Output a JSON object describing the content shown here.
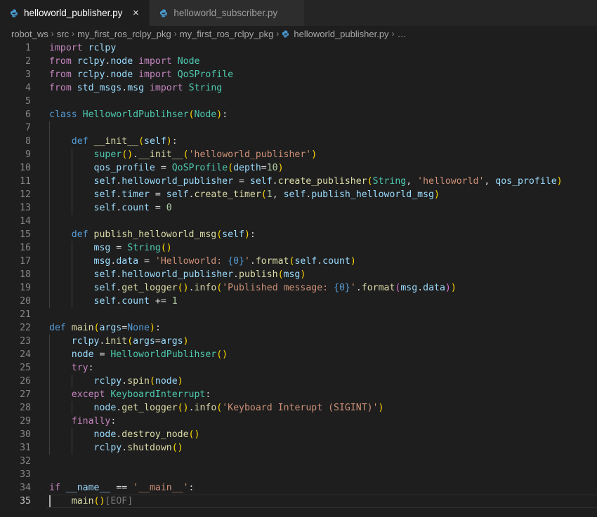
{
  "tabs": [
    {
      "label": "helloworld_publisher.py",
      "active": true,
      "close": "×"
    },
    {
      "label": "helloworld_subscriber.py",
      "active": false,
      "close": "×"
    }
  ],
  "breadcrumb": {
    "items": [
      "robot_ws",
      "src",
      "my_first_ros_rclpy_pkg",
      "my_first_ros_rclpy_pkg",
      "helloworld_publisher.py",
      "…"
    ]
  },
  "editor": {
    "current_line": 35,
    "lines": [
      [
        {
          "t": "import",
          "c": "k"
        },
        {
          "t": " "
        },
        {
          "t": "rclpy",
          "c": "v"
        }
      ],
      [
        {
          "t": "from",
          "c": "k"
        },
        {
          "t": " "
        },
        {
          "t": "rclpy",
          "c": "v"
        },
        {
          "t": "."
        },
        {
          "t": "node",
          "c": "v"
        },
        {
          "t": " "
        },
        {
          "t": "import",
          "c": "k"
        },
        {
          "t": " "
        },
        {
          "t": "Node",
          "c": "cl"
        }
      ],
      [
        {
          "t": "from",
          "c": "k"
        },
        {
          "t": " "
        },
        {
          "t": "rclpy",
          "c": "v"
        },
        {
          "t": "."
        },
        {
          "t": "node",
          "c": "v"
        },
        {
          "t": " "
        },
        {
          "t": "import",
          "c": "k"
        },
        {
          "t": " "
        },
        {
          "t": "QoSProfile",
          "c": "cl"
        }
      ],
      [
        {
          "t": "from",
          "c": "k"
        },
        {
          "t": " "
        },
        {
          "t": "std_msgs",
          "c": "v"
        },
        {
          "t": "."
        },
        {
          "t": "msg",
          "c": "v"
        },
        {
          "t": " "
        },
        {
          "t": "import",
          "c": "k"
        },
        {
          "t": " "
        },
        {
          "t": "String",
          "c": "cl"
        }
      ],
      [],
      [
        {
          "t": "class",
          "c": "kd"
        },
        {
          "t": " "
        },
        {
          "t": "HelloworldPublihser",
          "c": "cl"
        },
        {
          "t": "(",
          "c": "b1"
        },
        {
          "t": "Node",
          "c": "cl"
        },
        {
          "t": ")",
          "c": "b1"
        },
        {
          "t": ":"
        }
      ],
      [],
      [
        {
          "t": "    "
        },
        {
          "t": "def",
          "c": "kd"
        },
        {
          "t": " "
        },
        {
          "t": "__init__",
          "c": "fn"
        },
        {
          "t": "(",
          "c": "b1"
        },
        {
          "t": "self",
          "c": "v"
        },
        {
          "t": ")",
          "c": "b1"
        },
        {
          "t": ":"
        }
      ],
      [
        {
          "t": "        "
        },
        {
          "t": "super",
          "c": "cl"
        },
        {
          "t": "(",
          "c": "b1"
        },
        {
          "t": ")",
          "c": "b1"
        },
        {
          "t": "."
        },
        {
          "t": "__init__",
          "c": "fn"
        },
        {
          "t": "(",
          "c": "b1"
        },
        {
          "t": "'helloworld_publisher'",
          "c": "s"
        },
        {
          "t": ")",
          "c": "b1"
        }
      ],
      [
        {
          "t": "        "
        },
        {
          "t": "qos_profile",
          "c": "v"
        },
        {
          "t": " = "
        },
        {
          "t": "QoSProfile",
          "c": "cl"
        },
        {
          "t": "(",
          "c": "b1"
        },
        {
          "t": "depth",
          "c": "v"
        },
        {
          "t": "="
        },
        {
          "t": "10",
          "c": "n"
        },
        {
          "t": ")",
          "c": "b1"
        }
      ],
      [
        {
          "t": "        "
        },
        {
          "t": "self",
          "c": "v"
        },
        {
          "t": "."
        },
        {
          "t": "helloworld_publisher",
          "c": "v"
        },
        {
          "t": " = "
        },
        {
          "t": "self",
          "c": "v"
        },
        {
          "t": "."
        },
        {
          "t": "create_publisher",
          "c": "fn"
        },
        {
          "t": "(",
          "c": "b1"
        },
        {
          "t": "String",
          "c": "cl"
        },
        {
          "t": ", "
        },
        {
          "t": "'helloworld'",
          "c": "s"
        },
        {
          "t": ", "
        },
        {
          "t": "qos_profile",
          "c": "v"
        },
        {
          "t": ")",
          "c": "b1"
        }
      ],
      [
        {
          "t": "        "
        },
        {
          "t": "self",
          "c": "v"
        },
        {
          "t": "."
        },
        {
          "t": "timer",
          "c": "v"
        },
        {
          "t": " = "
        },
        {
          "t": "self",
          "c": "v"
        },
        {
          "t": "."
        },
        {
          "t": "create_timer",
          "c": "fn"
        },
        {
          "t": "(",
          "c": "b1"
        },
        {
          "t": "1",
          "c": "n"
        },
        {
          "t": ", "
        },
        {
          "t": "self",
          "c": "v"
        },
        {
          "t": "."
        },
        {
          "t": "publish_helloworld_msg",
          "c": "v"
        },
        {
          "t": ")",
          "c": "b1"
        }
      ],
      [
        {
          "t": "        "
        },
        {
          "t": "self",
          "c": "v"
        },
        {
          "t": "."
        },
        {
          "t": "count",
          "c": "v"
        },
        {
          "t": " = "
        },
        {
          "t": "0",
          "c": "n"
        }
      ],
      [],
      [
        {
          "t": "    "
        },
        {
          "t": "def",
          "c": "kd"
        },
        {
          "t": " "
        },
        {
          "t": "publish_helloworld_msg",
          "c": "fn"
        },
        {
          "t": "(",
          "c": "b1"
        },
        {
          "t": "self",
          "c": "v"
        },
        {
          "t": ")",
          "c": "b1"
        },
        {
          "t": ":"
        }
      ],
      [
        {
          "t": "        "
        },
        {
          "t": "msg",
          "c": "v"
        },
        {
          "t": " = "
        },
        {
          "t": "String",
          "c": "cl"
        },
        {
          "t": "(",
          "c": "b1"
        },
        {
          "t": ")",
          "c": "b1"
        }
      ],
      [
        {
          "t": "        "
        },
        {
          "t": "msg",
          "c": "v"
        },
        {
          "t": "."
        },
        {
          "t": "data",
          "c": "v"
        },
        {
          "t": " = "
        },
        {
          "t": "'Helloworld: ",
          "c": "s"
        },
        {
          "t": "{0}",
          "c": "fmt"
        },
        {
          "t": "'",
          "c": "s"
        },
        {
          "t": "."
        },
        {
          "t": "format",
          "c": "fn"
        },
        {
          "t": "(",
          "c": "b1"
        },
        {
          "t": "self",
          "c": "v"
        },
        {
          "t": "."
        },
        {
          "t": "count",
          "c": "v"
        },
        {
          "t": ")",
          "c": "b1"
        }
      ],
      [
        {
          "t": "        "
        },
        {
          "t": "self",
          "c": "v"
        },
        {
          "t": "."
        },
        {
          "t": "helloworld_publisher",
          "c": "v"
        },
        {
          "t": "."
        },
        {
          "t": "publish",
          "c": "fn"
        },
        {
          "t": "(",
          "c": "b1"
        },
        {
          "t": "msg",
          "c": "v"
        },
        {
          "t": ")",
          "c": "b1"
        }
      ],
      [
        {
          "t": "        "
        },
        {
          "t": "self",
          "c": "v"
        },
        {
          "t": "."
        },
        {
          "t": "get_logger",
          "c": "fn"
        },
        {
          "t": "(",
          "c": "b1"
        },
        {
          "t": ")",
          "c": "b1"
        },
        {
          "t": "."
        },
        {
          "t": "info",
          "c": "fn"
        },
        {
          "t": "(",
          "c": "b1"
        },
        {
          "t": "'Published message: ",
          "c": "s"
        },
        {
          "t": "{0}",
          "c": "fmt"
        },
        {
          "t": "'",
          "c": "s"
        },
        {
          "t": "."
        },
        {
          "t": "format",
          "c": "fn"
        },
        {
          "t": "(",
          "c": "b2"
        },
        {
          "t": "msg",
          "c": "v"
        },
        {
          "t": "."
        },
        {
          "t": "data",
          "c": "v"
        },
        {
          "t": ")",
          "c": "b2"
        },
        {
          "t": ")",
          "c": "b1"
        }
      ],
      [
        {
          "t": "        "
        },
        {
          "t": "self",
          "c": "v"
        },
        {
          "t": "."
        },
        {
          "t": "count",
          "c": "v"
        },
        {
          "t": " += "
        },
        {
          "t": "1",
          "c": "n"
        }
      ],
      [],
      [
        {
          "t": "def",
          "c": "kd"
        },
        {
          "t": " "
        },
        {
          "t": "main",
          "c": "fn"
        },
        {
          "t": "(",
          "c": "b1"
        },
        {
          "t": "args",
          "c": "v"
        },
        {
          "t": "="
        },
        {
          "t": "None",
          "c": "kd"
        },
        {
          "t": ")",
          "c": "b1"
        },
        {
          "t": ":"
        }
      ],
      [
        {
          "t": "    "
        },
        {
          "t": "rclpy",
          "c": "v"
        },
        {
          "t": "."
        },
        {
          "t": "init",
          "c": "fn"
        },
        {
          "t": "(",
          "c": "b1"
        },
        {
          "t": "args",
          "c": "v"
        },
        {
          "t": "="
        },
        {
          "t": "args",
          "c": "v"
        },
        {
          "t": ")",
          "c": "b1"
        }
      ],
      [
        {
          "t": "    "
        },
        {
          "t": "node",
          "c": "v"
        },
        {
          "t": " = "
        },
        {
          "t": "HelloworldPublihser",
          "c": "cl"
        },
        {
          "t": "(",
          "c": "b1"
        },
        {
          "t": ")",
          "c": "b1"
        }
      ],
      [
        {
          "t": "    "
        },
        {
          "t": "try",
          "c": "k"
        },
        {
          "t": ":"
        }
      ],
      [
        {
          "t": "        "
        },
        {
          "t": "rclpy",
          "c": "v"
        },
        {
          "t": "."
        },
        {
          "t": "spin",
          "c": "fn"
        },
        {
          "t": "(",
          "c": "b1"
        },
        {
          "t": "node",
          "c": "v"
        },
        {
          "t": ")",
          "c": "b1"
        }
      ],
      [
        {
          "t": "    "
        },
        {
          "t": "except",
          "c": "k"
        },
        {
          "t": " "
        },
        {
          "t": "KeyboardInterrupt",
          "c": "cl"
        },
        {
          "t": ":"
        }
      ],
      [
        {
          "t": "        "
        },
        {
          "t": "node",
          "c": "v"
        },
        {
          "t": "."
        },
        {
          "t": "get_logger",
          "c": "fn"
        },
        {
          "t": "(",
          "c": "b1"
        },
        {
          "t": ")",
          "c": "b1"
        },
        {
          "t": "."
        },
        {
          "t": "info",
          "c": "fn"
        },
        {
          "t": "(",
          "c": "b1"
        },
        {
          "t": "'Keyboard Interupt (SIGINT)'",
          "c": "s"
        },
        {
          "t": ")",
          "c": "b1"
        }
      ],
      [
        {
          "t": "    "
        },
        {
          "t": "finally",
          "c": "k"
        },
        {
          "t": ":"
        }
      ],
      [
        {
          "t": "        "
        },
        {
          "t": "node",
          "c": "v"
        },
        {
          "t": "."
        },
        {
          "t": "destroy_node",
          "c": "fn"
        },
        {
          "t": "(",
          "c": "b1"
        },
        {
          "t": ")",
          "c": "b1"
        }
      ],
      [
        {
          "t": "        "
        },
        {
          "t": "rclpy",
          "c": "v"
        },
        {
          "t": "."
        },
        {
          "t": "shutdown",
          "c": "fn"
        },
        {
          "t": "(",
          "c": "b1"
        },
        {
          "t": ")",
          "c": "b1"
        }
      ],
      [],
      [],
      [
        {
          "t": "if",
          "c": "k"
        },
        {
          "t": " "
        },
        {
          "t": "__name__",
          "c": "v"
        },
        {
          "t": " == "
        },
        {
          "t": "'__main__'",
          "c": "s"
        },
        {
          "t": ":"
        }
      ],
      [
        {
          "t": "    "
        },
        {
          "t": "main",
          "c": "fn"
        },
        {
          "t": "(",
          "c": "b1"
        },
        {
          "t": ")",
          "c": "b1"
        },
        {
          "t": "[EOF]",
          "c": "eof"
        }
      ]
    ]
  }
}
